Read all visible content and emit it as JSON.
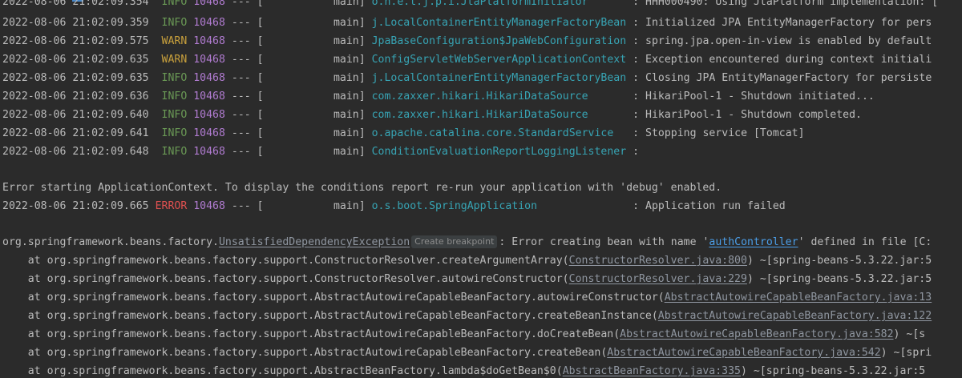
{
  "log_lines": [
    {
      "ts": "2022-08-06 21:02:09.354",
      "level": "INFO",
      "pid": "10468",
      "sep": "---",
      "thread": "[           main]",
      "logger": "o.h.e.t.j.p.i.JtaPlatformInitiator      ",
      "msg": " : HHH000490: Using JtaPlatform implementation: ["
    },
    {
      "ts": "2022-08-06 21:02:09.359",
      "level": "INFO",
      "pid": "10468",
      "sep": "---",
      "thread": "[           main]",
      "logger": "j.LocalContainerEntityManagerFactoryBean",
      "msg": " : Initialized JPA EntityManagerFactory for pers"
    },
    {
      "ts": "2022-08-06 21:02:09.575",
      "level": "WARN",
      "pid": "10468",
      "sep": "---",
      "thread": "[           main]",
      "logger": "JpaBaseConfiguration$JpaWebConfiguration",
      "msg": " : spring.jpa.open-in-view is enabled by default"
    },
    {
      "ts": "2022-08-06 21:02:09.635",
      "level": "WARN",
      "pid": "10468",
      "sep": "---",
      "thread": "[           main]",
      "logger": "ConfigServletWebServerApplicationContext",
      "msg": " : Exception encountered during context initiali"
    },
    {
      "ts": "2022-08-06 21:02:09.635",
      "level": "INFO",
      "pid": "10468",
      "sep": "---",
      "thread": "[           main]",
      "logger": "j.LocalContainerEntityManagerFactoryBean",
      "msg": " : Closing JPA EntityManagerFactory for persiste"
    },
    {
      "ts": "2022-08-06 21:02:09.636",
      "level": "INFO",
      "pid": "10468",
      "sep": "---",
      "thread": "[           main]",
      "logger": "com.zaxxer.hikari.HikariDataSource      ",
      "msg": " : HikariPool-1 - Shutdown initiated..."
    },
    {
      "ts": "2022-08-06 21:02:09.640",
      "level": "INFO",
      "pid": "10468",
      "sep": "---",
      "thread": "[           main]",
      "logger": "com.zaxxer.hikari.HikariDataSource      ",
      "msg": " : HikariPool-1 - Shutdown completed."
    },
    {
      "ts": "2022-08-06 21:02:09.641",
      "level": "INFO",
      "pid": "10468",
      "sep": "---",
      "thread": "[           main]",
      "logger": "o.apache.catalina.core.StandardService  ",
      "msg": " : Stopping service [Tomcat]"
    },
    {
      "ts": "2022-08-06 21:02:09.648",
      "level": "INFO",
      "pid": "10468",
      "sep": "---",
      "thread": "[           main]",
      "logger": "ConditionEvaluationReportLoggingListener",
      "msg": " :"
    }
  ],
  "error_message": "Error starting ApplicationContext. To display the conditions report re-run your application with 'debug' enabled.",
  "error_line": {
    "ts": "2022-08-06 21:02:09.665",
    "level": "ERROR",
    "pid": "10468",
    "sep": "---",
    "thread": "[           main]",
    "logger": "o.s.boot.SpringApplication              ",
    "msg": " : Application run failed"
  },
  "exception": {
    "prefix": "org.springframework.beans.factory.",
    "class_link": "UnsatisfiedDependencyException",
    "breakpoint_label": "Create breakpoint",
    "message_before": ": Error creating bean with name '",
    "bean_name": "authController",
    "message_after": "' defined in file [C:"
  },
  "stack_frames": [
    {
      "at": "    at org.springframework.beans.factory.support.ConstructorResolver.createArgumentArray(",
      "source": "ConstructorResolver.java:800",
      "tail": ") ~[spring-beans-5.3.22.jar:5"
    },
    {
      "at": "    at org.springframework.beans.factory.support.ConstructorResolver.autowireConstructor(",
      "source": "ConstructorResolver.java:229",
      "tail": ") ~[spring-beans-5.3.22.jar:5"
    },
    {
      "at": "    at org.springframework.beans.factory.support.AbstractAutowireCapableBeanFactory.autowireConstructor(",
      "source": "AbstractAutowireCapableBeanFactory.java:13",
      "tail": ""
    },
    {
      "at": "    at org.springframework.beans.factory.support.AbstractAutowireCapableBeanFactory.createBeanInstance(",
      "source": "AbstractAutowireCapableBeanFactory.java:122",
      "tail": ""
    },
    {
      "at": "    at org.springframework.beans.factory.support.AbstractAutowireCapableBeanFactory.doCreateBean(",
      "source": "AbstractAutowireCapableBeanFactory.java:582",
      "tail": ") ~[s"
    },
    {
      "at": "    at org.springframework.beans.factory.support.AbstractAutowireCapableBeanFactory.createBean(",
      "source": "AbstractAutowireCapableBeanFactory.java:542",
      "tail": ") ~[spri"
    },
    {
      "at": "    at org.springframework.beans.factory.support.AbstractBeanFactory.lambda$doGetBean$0(",
      "source": "AbstractBeanFactory.java:335",
      "tail": ") ~[spring-beans-5.3.22.jar:5"
    }
  ],
  "colors": {
    "background": "#2b2b2b",
    "text": "#bbbbbb",
    "info": "#6a9955",
    "warn": "#c8a03c",
    "error": "#e05050",
    "pid": "#b07bd0",
    "logger": "#37a4b4",
    "link": "#8f96a0",
    "bean_link": "#4b9ee8"
  }
}
